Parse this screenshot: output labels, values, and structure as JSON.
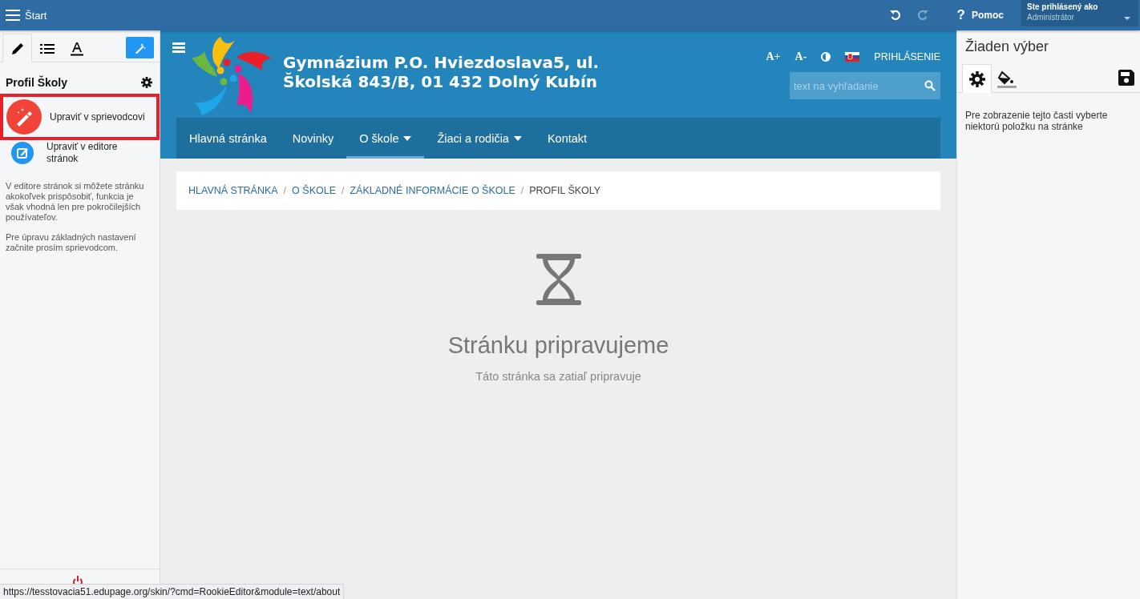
{
  "topbar": {
    "title": "Štart",
    "undo_disabled": false,
    "redo_disabled": true,
    "help_mark": "?",
    "help_label": "Pomoc",
    "user_label": "Ste prihlásený ako",
    "user_name": "Administrátor"
  },
  "left_panel": {
    "tabs": [
      {
        "kind": "pencil",
        "selected": true
      },
      {
        "kind": "list",
        "selected": false
      },
      {
        "kind": "font",
        "selected": false
      }
    ],
    "section_title": "Profil Školy",
    "actions": [
      {
        "kind": "wizard",
        "label": "Upraviť v sprievodcovi",
        "highlighted": true
      },
      {
        "kind": "editor",
        "label": "Upraviť v editore stránok",
        "highlighted": false
      }
    ],
    "paragraphs": [
      "V editore stránok si môžete stránku akokoľvek prispôsobiť, funkcia je však vhodná len pre pokročilejších používateľov.",
      "Pre úpravu základných nastavení začnite prosím sprievodcom."
    ]
  },
  "site": {
    "title_lines": [
      "Gymnázium P.O. Hviezdoslava5, ul.",
      "Školská 843/B, 01 432 Dolný Kubín"
    ],
    "font_larger": "A+",
    "font_smaller": "A-",
    "login": "PRIHLÁSENIE",
    "search": {
      "placeholder": "text na vyhľadanie"
    },
    "nav": [
      {
        "label": "Hlavná stránka",
        "selected": false,
        "dropdown": false
      },
      {
        "label": "Novinky",
        "selected": false,
        "dropdown": false
      },
      {
        "label": "O škole",
        "selected": true,
        "dropdown": true
      },
      {
        "label": "Žiaci a rodičia",
        "selected": false,
        "dropdown": true
      },
      {
        "label": "Kontakt",
        "selected": false,
        "dropdown": false
      }
    ],
    "breadcrumb_separator": "/",
    "breadcrumb": [
      {
        "label": "HLAVNÁ STRÁNKA",
        "current": false
      },
      {
        "label": "O ŠKOLE",
        "current": false
      },
      {
        "label": "ZÁKLADNÉ INFORMÁCIE O ŠKOLE",
        "current": false
      },
      {
        "label": "PROFIL ŠKOLY",
        "current": true
      }
    ],
    "empty_title": "Stránku pripravujeme",
    "empty_subtitle": "Táto stránka sa zatiaľ pripravuje"
  },
  "right_panel": {
    "title": "Žiaden výber",
    "tabs": [
      {
        "kind": "gear",
        "selected": true
      },
      {
        "kind": "paint",
        "selected": false
      }
    ],
    "message": "Pre zobrazenie tejto časti vyberte niektorú položku na stránke"
  },
  "status_url": "https://tesstovacia51.edupage.org/skin/?cmd=RookieEditor&module=text/about"
}
